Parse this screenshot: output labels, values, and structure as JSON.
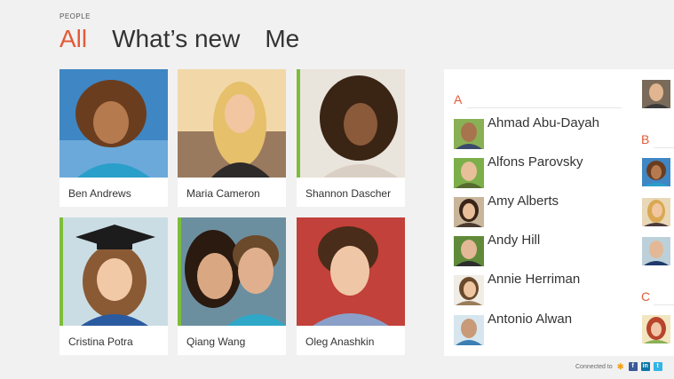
{
  "app": {
    "label": "PEOPLE"
  },
  "pivot": {
    "tabs": [
      {
        "label": "All"
      },
      {
        "label": "What’s new"
      },
      {
        "label": "Me"
      }
    ]
  },
  "tiles": [
    {
      "name": "Ben Andrews"
    },
    {
      "name": "Maria Cameron"
    },
    {
      "name": "Shannon Dascher"
    },
    {
      "name": "Cristina Potra"
    },
    {
      "name": "Qiang Wang"
    },
    {
      "name": "Oleg Anashkin"
    }
  ],
  "list": {
    "sections": [
      {
        "letter": "A"
      },
      {
        "letter": "B"
      },
      {
        "letter": "C"
      }
    ],
    "contacts": [
      {
        "name": "Ahmad Abu-Dayah"
      },
      {
        "name": "Alfons Parovsky"
      },
      {
        "name": "Amy Alberts"
      },
      {
        "name": "Andy Hill"
      },
      {
        "name": "Annie Herriman"
      },
      {
        "name": "Antonio Alwan"
      }
    ]
  },
  "footer": {
    "connected_label": "Connected to",
    "services": [
      {
        "icon": "windows-live-icon",
        "color": "#f2a31b"
      },
      {
        "icon": "facebook-icon",
        "color": "#3b5998"
      },
      {
        "icon": "linkedin-icon",
        "color": "#0e76a8"
      },
      {
        "icon": "twitter-icon",
        "color": "#33b5e5"
      }
    ]
  },
  "colors": {
    "accent": "#e25a38",
    "tile_accent": "#7dbd3a"
  }
}
